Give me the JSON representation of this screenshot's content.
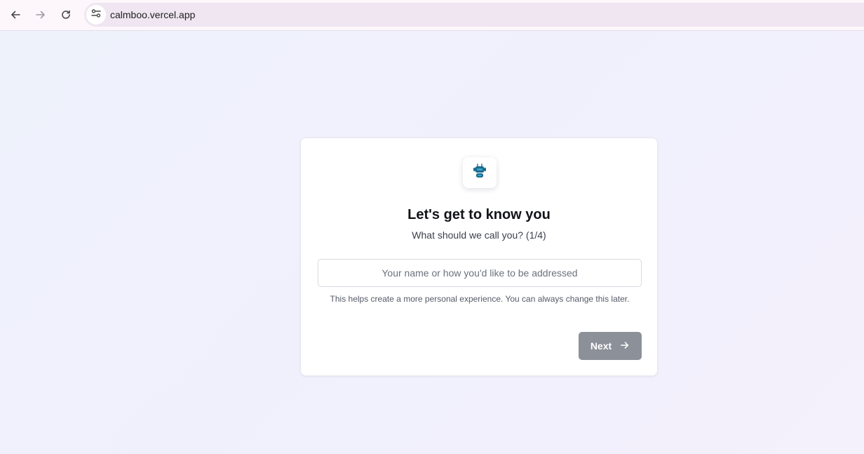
{
  "browser": {
    "url": "calmboo.vercel.app",
    "icons": {
      "back": "arrow-left-icon",
      "forward": "arrow-right-icon",
      "reload": "reload-icon",
      "site_info": "tune-icon"
    }
  },
  "onboarding": {
    "logo_icon": "robot-icon",
    "title": "Let's get to know you",
    "subtitle": "What should we call you? (1/4)",
    "name_input": {
      "value": "",
      "placeholder": "Your name or how you'd like to be addressed"
    },
    "helper_text": "This helps create a more personal experience. You can always change this later.",
    "next_label": "Next",
    "next_icon": "arrow-right-icon",
    "step_current": 1,
    "step_total": 4
  },
  "colors": {
    "brand": "#1d6b8f",
    "button_disabled": "#8c9098",
    "background": "#eef2fb"
  }
}
